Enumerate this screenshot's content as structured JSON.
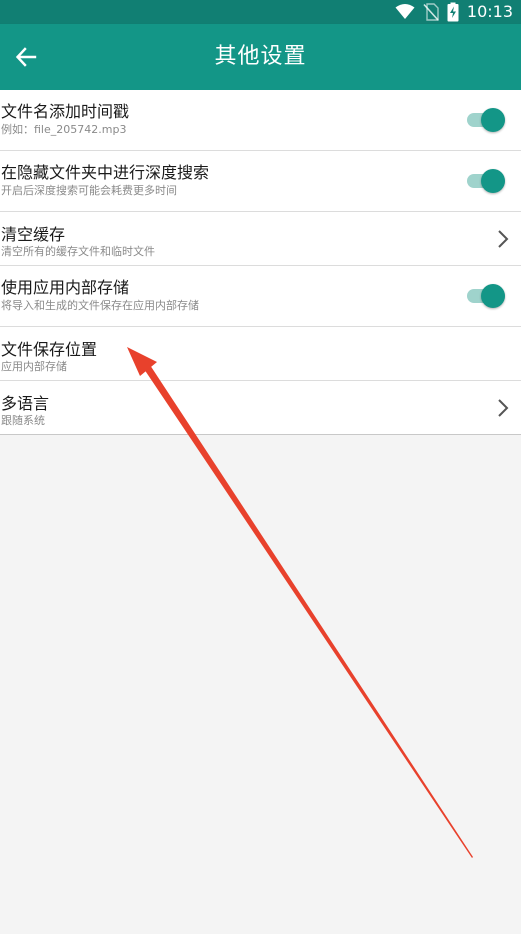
{
  "status_bar": {
    "time": "10:13",
    "icons": [
      "wifi-icon",
      "no-sim-icon",
      "battery-charging-icon"
    ]
  },
  "app_bar": {
    "back_icon": "arrow-left-icon",
    "title": "其他设置"
  },
  "colors": {
    "status_bar": "#117f73",
    "app_bar": "#139687",
    "toggle_on_thumb": "#139687",
    "toggle_on_track": "#9fd3cc",
    "background": "#f4f4f4",
    "annotation_arrow": "#e8412c"
  },
  "settings": [
    {
      "title": "文件名添加时间戳",
      "subtitle": "例如：file_205742.mp3",
      "control": "toggle",
      "checked": true
    },
    {
      "title": "在隐藏文件夹中进行深度搜索",
      "subtitle": "开启后深度搜索可能会耗费更多时间",
      "control": "toggle",
      "checked": true
    },
    {
      "title": "清空缓存",
      "subtitle": "清空所有的缓存文件和临时文件",
      "control": "chevron"
    },
    {
      "title": "使用应用内部存储",
      "subtitle": "将导入和生成的文件保存在应用内部存储",
      "control": "toggle",
      "checked": true
    },
    {
      "title": "文件保存位置",
      "subtitle": "应用内部存储",
      "control": "none"
    },
    {
      "title": "多语言",
      "subtitle": "跟随系统",
      "control": "chevron"
    }
  ]
}
